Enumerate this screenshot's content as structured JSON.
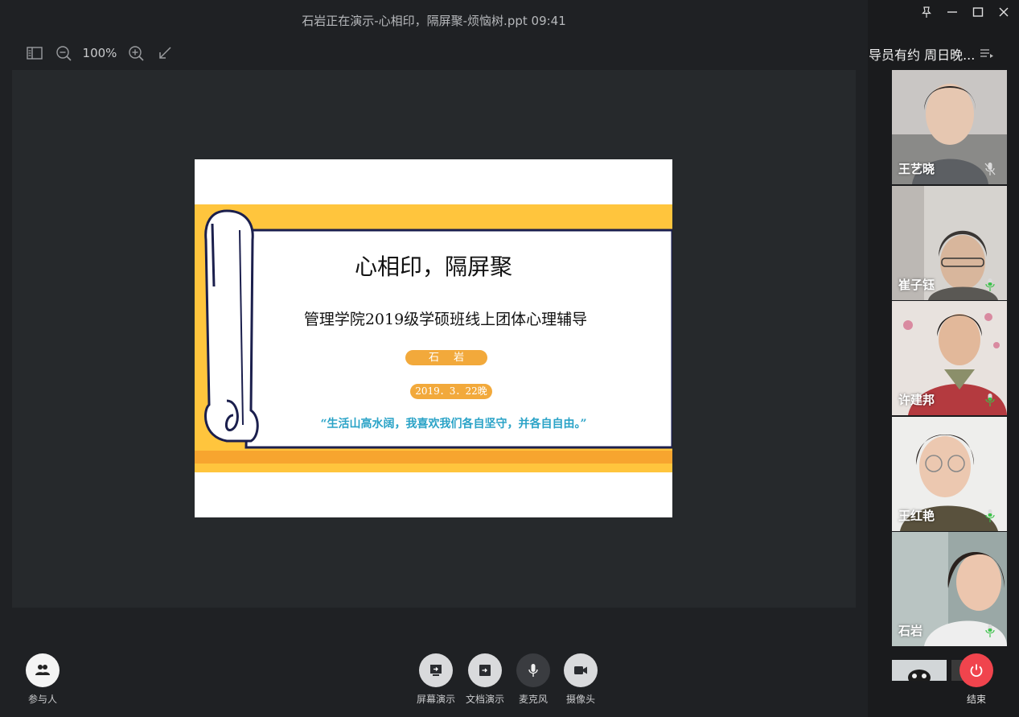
{
  "window": {
    "title": "石岩正在演示-心相印，隔屏聚-烦恼树.ppt 09:41"
  },
  "toolbar": {
    "zoom_level": "100%"
  },
  "slide": {
    "title": "心相印，隔屏聚",
    "subtitle": "管理学院2019级学硕班线上团体心理辅导",
    "presenter": "石岩",
    "date": "2019．3．22晚",
    "quote": "“生活山高水阔，我喜欢我们各自坚守，并各自自由。”"
  },
  "bottom_bar": {
    "participants_label": "参与人",
    "screen_share_label": "屏幕演示",
    "doc_share_label": "文档演示",
    "mic_label": "麦克风",
    "camera_label": "摄像头"
  },
  "side_panel": {
    "meeting_name": "导员有约 周日晚...",
    "participants": [
      {
        "name": "王艺晓",
        "mic": "muted"
      },
      {
        "name": "崔子钰",
        "mic": "on"
      },
      {
        "name": "许建邦",
        "mic": "on"
      },
      {
        "name": "王红艳",
        "mic": "on"
      },
      {
        "name": "石岩",
        "mic": "on"
      }
    ],
    "end_label": "结束"
  },
  "colors": {
    "accent_orange": "#f2a93b",
    "scroll_yellow": "#ffc53d",
    "quote_blue": "#2aa3c7",
    "end_red": "#f0444d",
    "mic_green": "#3cc24a"
  }
}
